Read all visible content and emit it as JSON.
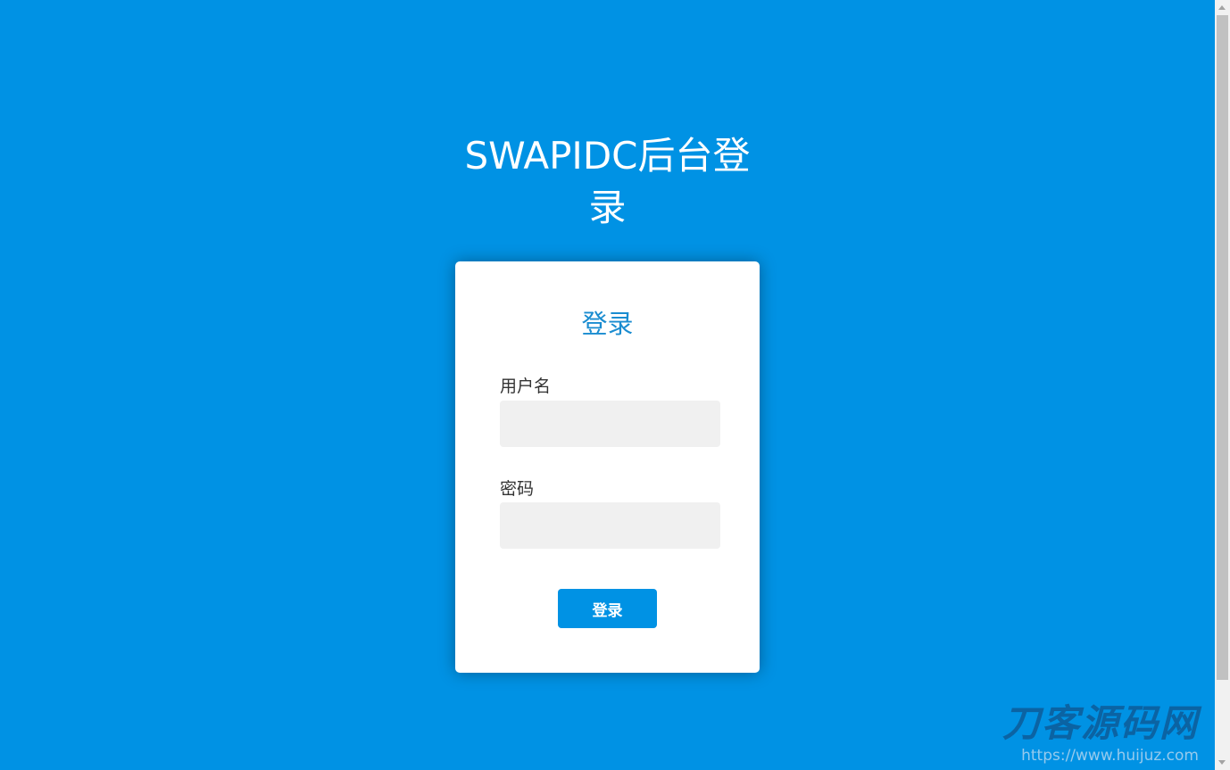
{
  "page": {
    "title": "SWAPIDC后台登录",
    "background_color": "#0092e4"
  },
  "login_card": {
    "title": "登录",
    "title_color": "#1a8cd0",
    "username_label": "用户名",
    "username_value": "",
    "password_label": "密码",
    "password_value": "",
    "submit_label": "登录"
  },
  "watermark": {
    "logo_text": "刀客源码网",
    "url_text": "https://www.huijuz.com"
  },
  "icons": {
    "scroll_up": "scroll-up-arrow-icon",
    "scroll_down": "scroll-down-arrow-icon"
  }
}
